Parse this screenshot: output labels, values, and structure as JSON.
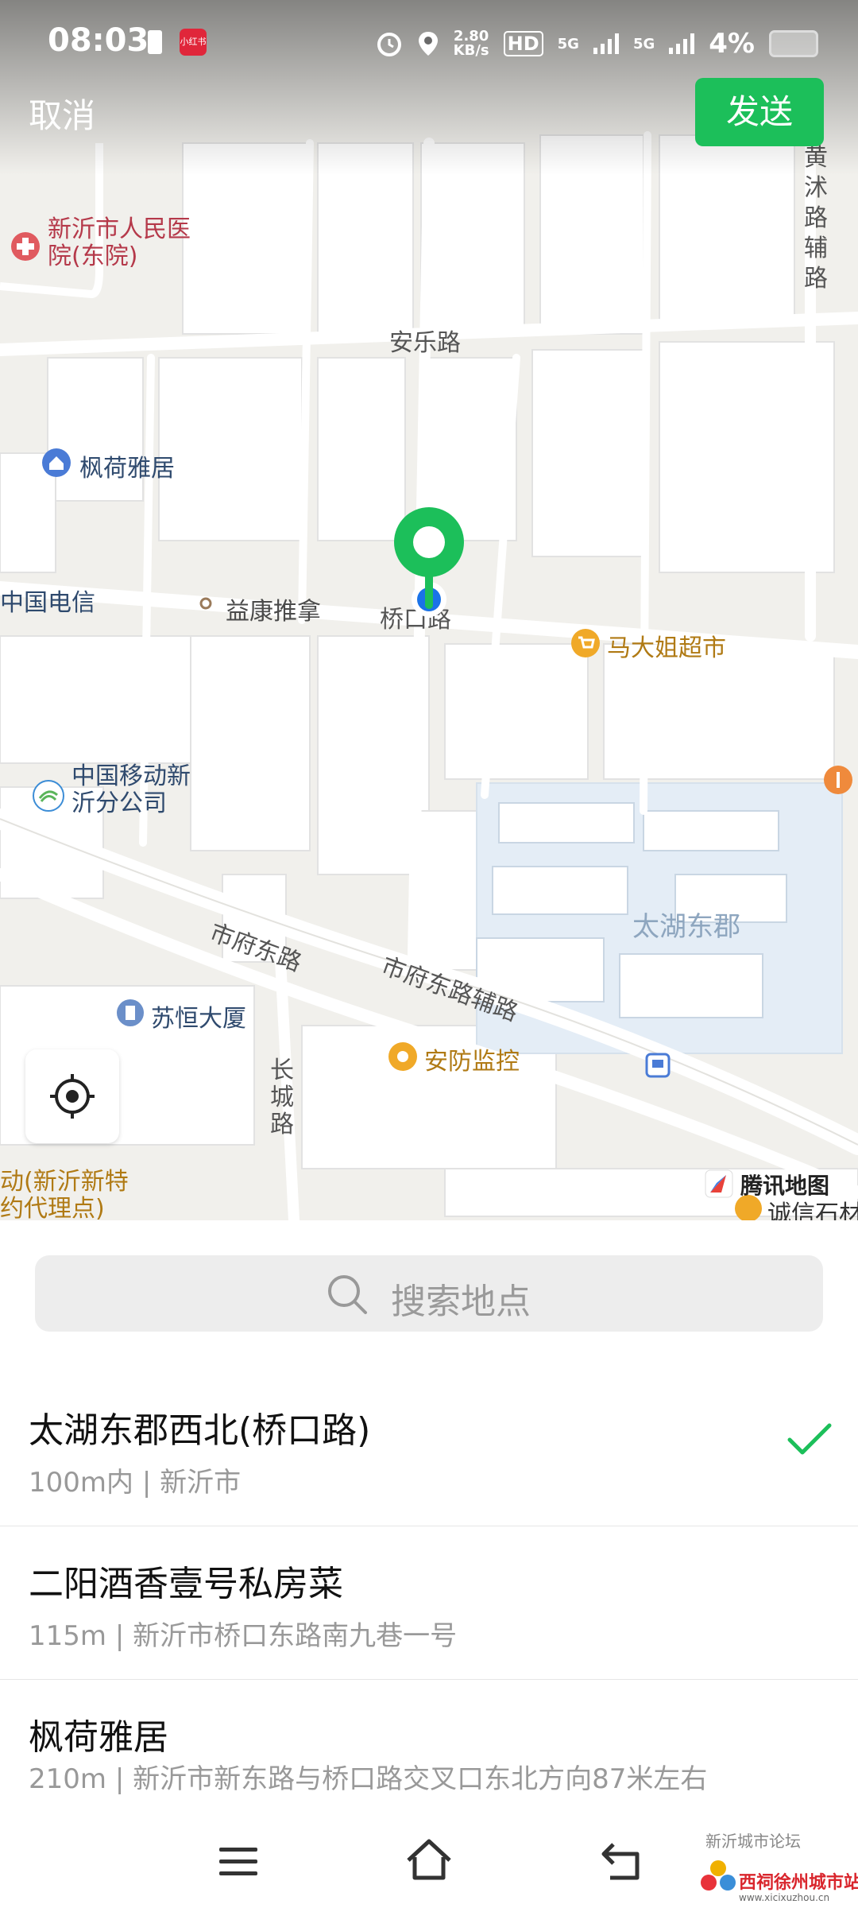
{
  "status_bar": {
    "time": "08:03",
    "app_badge": "小红书",
    "net_speed_value": "2.80",
    "net_speed_unit": "KB/s",
    "hd": "HD",
    "sim1": "5G",
    "sim2": "5G",
    "battery": "4%"
  },
  "header": {
    "cancel_label": "取消",
    "send_label": "发送"
  },
  "map": {
    "roads": {
      "anle": "安乐路",
      "qiaokou": "桥口路",
      "shifu_east": "市府东路",
      "shifu_east_aux": "市府东路辅路",
      "changcheng": "长城路",
      "huangmu": "黄沭路辅路"
    },
    "pois": {
      "hospital": "新沂市人民医院(东院)",
      "fenghe": "枫荷雅居",
      "telecom": "中国电信",
      "yikang": "益康推拿",
      "madajie": "马大姐超市",
      "mobile": "中国移动新沂分公司",
      "taihu": "太湖东郡",
      "suheng": "苏恒大厦",
      "anfang": "安防监控",
      "dianxin_left": "动(新沂新特约代理点)",
      "chengxin": "诚信石材"
    },
    "logo": "腾讯地图",
    "pin_color": "#1cbf5a",
    "location_dot_color": "#1a73e8"
  },
  "search": {
    "placeholder": "搜索地点"
  },
  "results": [
    {
      "name": "太湖东郡西北(桥口路)",
      "distance": "100m内",
      "address": "新沂市",
      "selected": true
    },
    {
      "name": "二阳酒香壹号私房菜",
      "distance": "115m",
      "address": "新沂市桥口东路南九巷一号",
      "selected": false
    },
    {
      "name": "枫荷雅居",
      "distance": "210m",
      "address": "新沂市新东路与桥口路交叉口东北方向87米左右",
      "selected": false
    }
  ],
  "watermark": {
    "top": "新沂城市论坛",
    "brand": "西祠徐州城市站",
    "url": "www.xicixuzhou.cn"
  }
}
